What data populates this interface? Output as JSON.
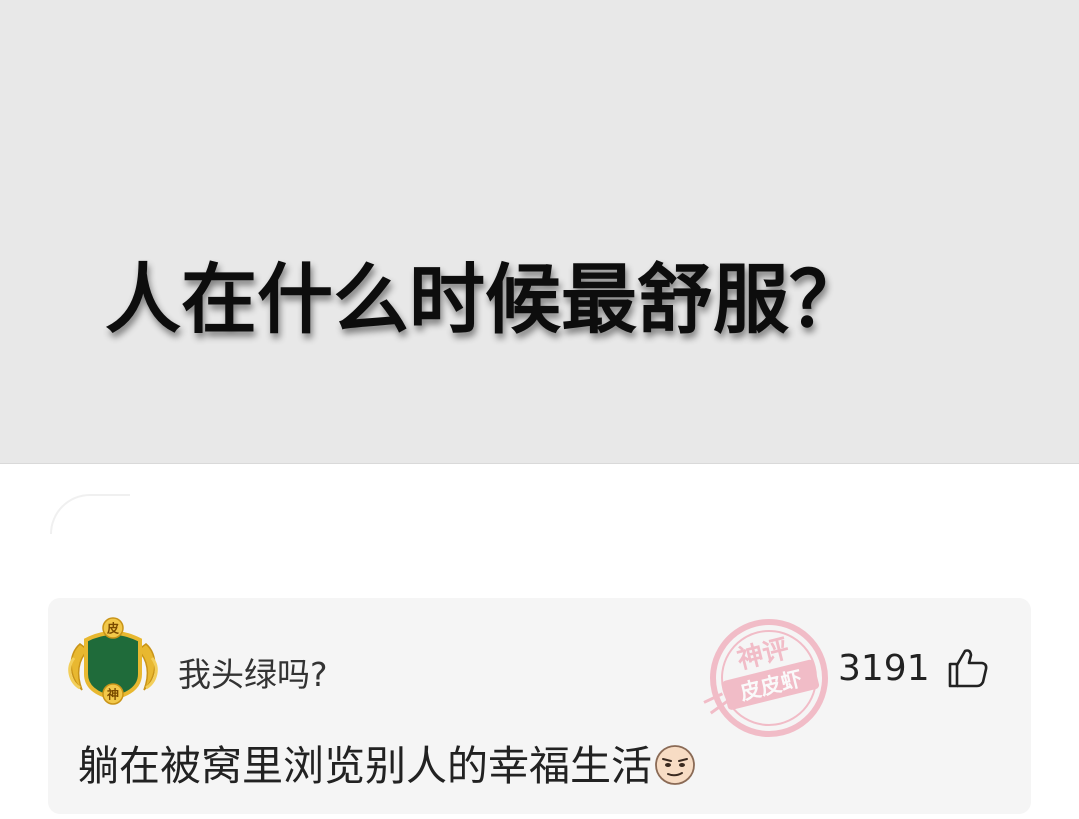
{
  "post": {
    "image_text": "人在什么时候最舒服？"
  },
  "comment": {
    "username": "我头绿吗?",
    "like_count": "3191",
    "text": "躺在被窝里浏览别人的幸福生活",
    "avatar_badge_top": "皮",
    "avatar_badge_bottom": "神",
    "stamp_text_top": "神评",
    "stamp_text_bottom": "皮皮虾",
    "emoji": "smirk-face-icon"
  },
  "colors": {
    "hero_bg": "#e8e8e8",
    "card_bg": "#f5f5f5",
    "avatar_green": "#1f6b3a",
    "avatar_gold": "#e8b830",
    "stamp_pink": "#f2a0b0"
  }
}
